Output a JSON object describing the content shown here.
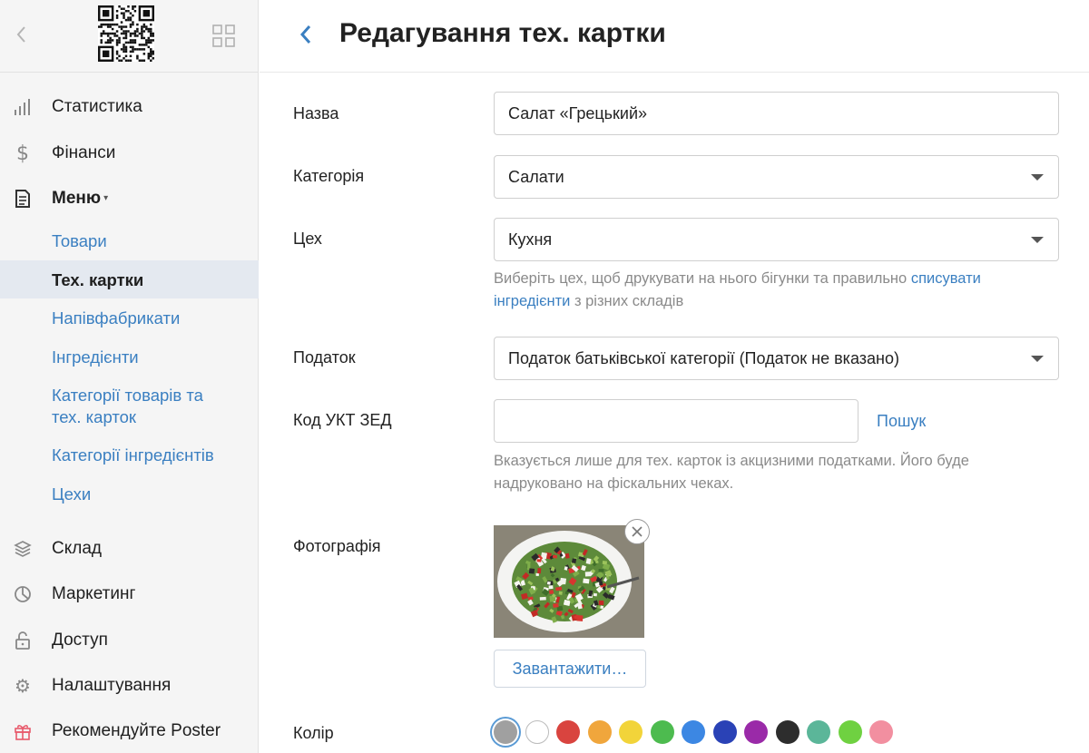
{
  "header": {
    "title": "Редагування тех. картки"
  },
  "sidebar": {
    "items": [
      {
        "label": "Статистика",
        "icon": "bar-chart-icon"
      },
      {
        "label": "Фінанси",
        "icon": "dollar-icon"
      },
      {
        "label": "Меню",
        "icon": "document-icon"
      },
      {
        "label": "Склад",
        "icon": "layers-icon"
      },
      {
        "label": "Маркетинг",
        "icon": "pie-chart-icon"
      },
      {
        "label": "Доступ",
        "icon": "lock-icon"
      },
      {
        "label": "Налаштування",
        "icon": "gear-icon"
      },
      {
        "label": "Рекомендуйте Poster",
        "icon": "gift-icon"
      }
    ],
    "menu_sub": [
      {
        "label": "Товари"
      },
      {
        "label": "Тех. картки",
        "active": true
      },
      {
        "label": "Напівфабрикати"
      },
      {
        "label": "Інгредієнти"
      },
      {
        "label": "Категорії товарів та"
      },
      {
        "label": "тех. карток"
      },
      {
        "label": "Категорії інгредієнтів"
      },
      {
        "label": "Цехи"
      }
    ]
  },
  "form": {
    "name": {
      "label": "Назва",
      "value": "Салат «Грецький»"
    },
    "category": {
      "label": "Категорія",
      "value": "Салати"
    },
    "workshop": {
      "label": "Цех",
      "value": "Кухня",
      "hint_1": "Виберіть цех, щоб друкувати на нього бігунки та правильно ",
      "hint_link_1": "списувати",
      "hint_link_2": "інгредієнти",
      "hint_2": " з різних складів"
    },
    "tax": {
      "label": "Податок",
      "value": "Податок батьківської категорії (Податок не вказано)"
    },
    "uktzed": {
      "label": "Код УКТ ЗЕД",
      "value": "",
      "search_label": "Пошук",
      "hint_line_1": "Вказується лише для тех. карток із акцизними податками. Його буде",
      "hint_line_2": "надруковано на фіскальних чеках."
    },
    "photo": {
      "label": "Фотографія",
      "upload_label": "Завантажити…"
    },
    "color": {
      "label": "Колір",
      "swatches": [
        "#a0a0a0",
        "#ffffff",
        "#d9443f",
        "#f0a63c",
        "#f2d43a",
        "#4dbb4f",
        "#3c87e3",
        "#2a42b6",
        "#9a2aa8",
        "#2d2d2d",
        "#5bb699",
        "#6fd141",
        "#f28fa0"
      ],
      "selected_index": 0
    }
  }
}
